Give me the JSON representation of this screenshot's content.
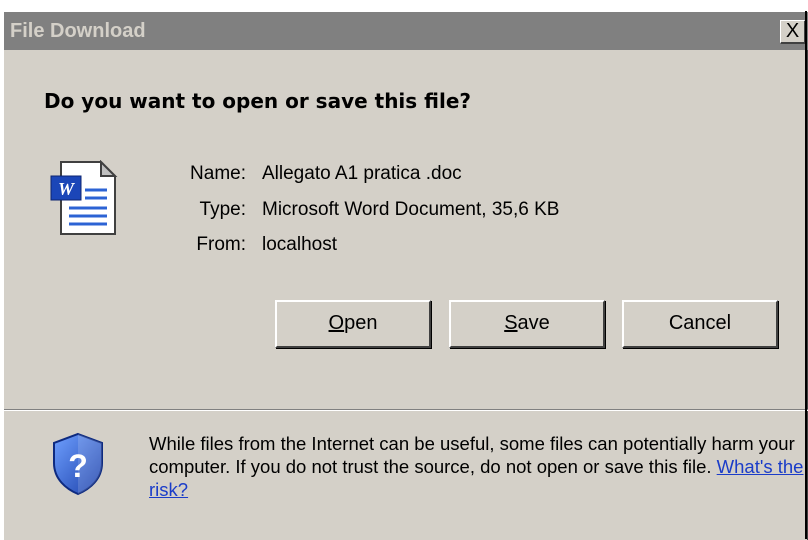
{
  "window": {
    "title": "File Download",
    "close_label": "X"
  },
  "prompt": "Do you want to open or save this file?",
  "file": {
    "icon": "word-document-icon",
    "name_label": "Name:",
    "name_value": "Allegato A1 pratica .doc",
    "type_label": "Type:",
    "type_value": "Microsoft Word Document, 35,6 KB",
    "from_label": "From:",
    "from_value": "localhost"
  },
  "buttons": {
    "open_underline": "O",
    "open_rest": "pen",
    "save_underline": "S",
    "save_rest": "ave",
    "cancel": "Cancel"
  },
  "warning": {
    "icon": "shield-question-icon",
    "text": "While files from the Internet can be useful, some files can potentially harm your computer. If you do not trust the source, do not open or save this file.",
    "link": "What's the risk?"
  },
  "colors": {
    "dialog_bg": "#d4d0c8",
    "titlebar_bg": "#808080",
    "link": "#1a3cc9"
  }
}
